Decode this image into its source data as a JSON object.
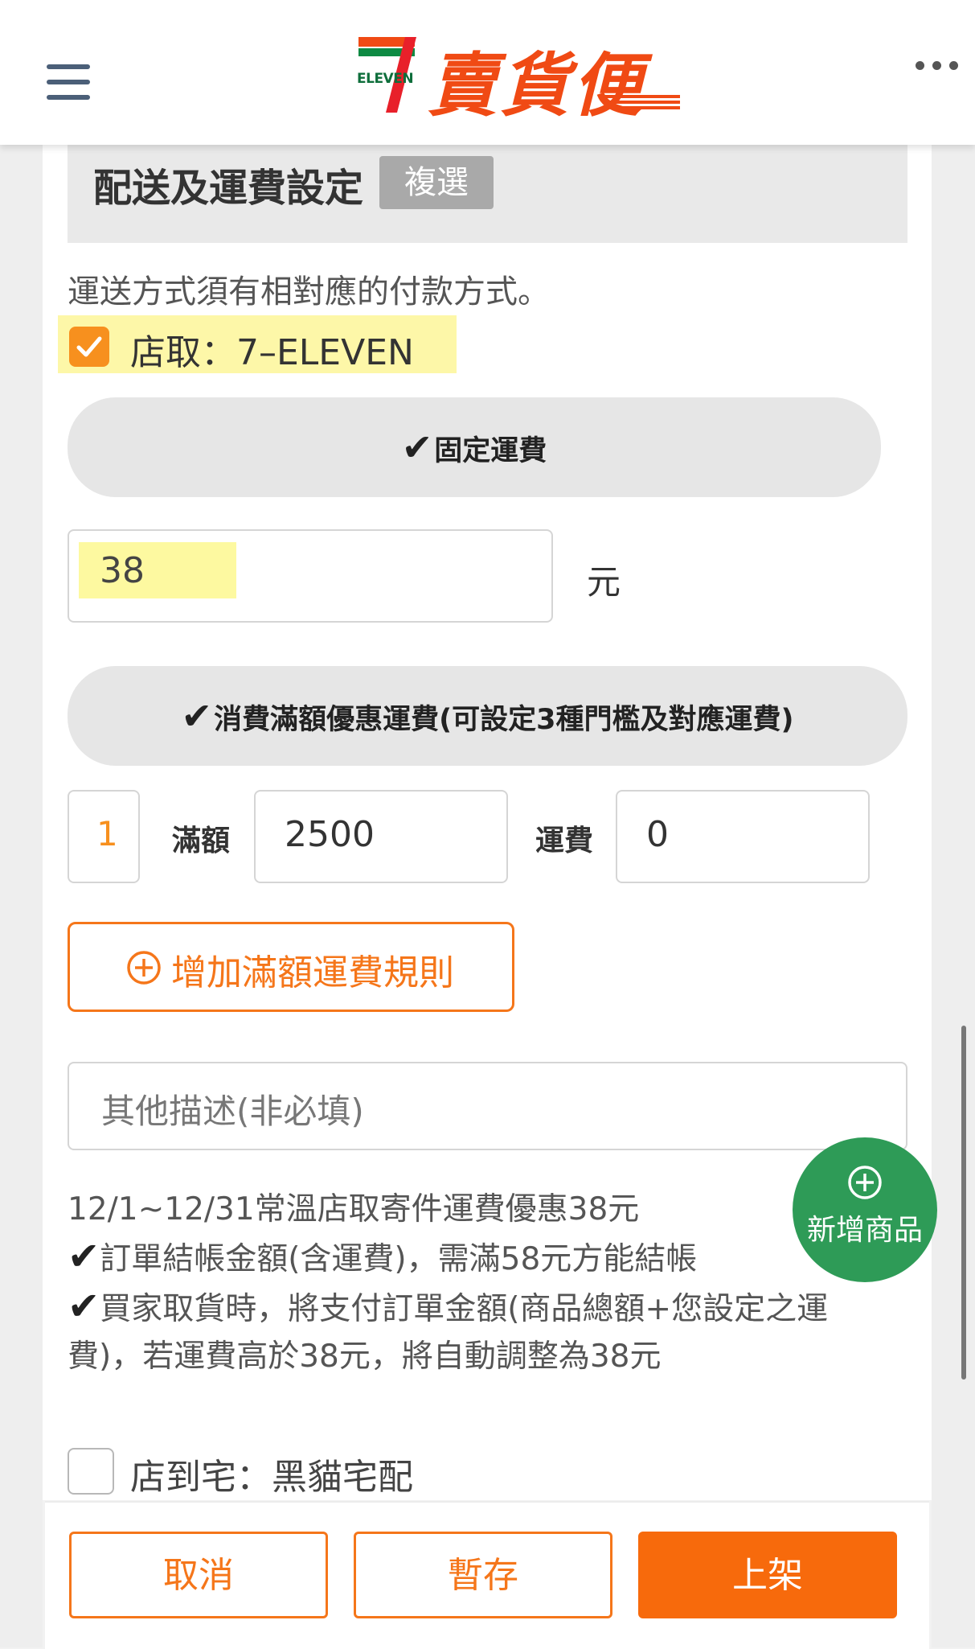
{
  "header": {
    "logo_eleven": "ELEVEN",
    "logo_text": "賣貨便"
  },
  "shipping_section": {
    "title": "配送及運費設定",
    "multi_select_tag": "複選",
    "hint": "運送方式須有相對應的付款方式。",
    "store_pickup": {
      "label": "店取：7–ELEVEN",
      "checked": true
    },
    "fixed_fee": {
      "pill_label": "固定運費",
      "value": "38",
      "unit": "元"
    },
    "threshold": {
      "pill_label": "消費滿額優惠運費(可設定3種門檻及對應運費)",
      "rules": [
        {
          "index": "1",
          "amount_label": "滿額",
          "amount": "2500",
          "fee_label": "運費",
          "fee": "0"
        }
      ],
      "add_rule_label": "增加滿額運費規則"
    },
    "description_placeholder": "其他描述(非必填)",
    "notes": [
      {
        "check": false,
        "text": "12/1~12/31常溫店取寄件運費優惠38元"
      },
      {
        "check": true,
        "text": "訂單結帳金額(含運費)，需滿58元方能結帳"
      },
      {
        "check": true,
        "text": "買家取貨時，將支付訂單金額(商品總額+您設定之運"
      },
      {
        "check": false,
        "text": "費)，若運費高於38元，將自動調整為38元"
      }
    ],
    "home_delivery": {
      "label": "店到宅：黑貓宅配",
      "checked": false
    }
  },
  "fab": {
    "label": "新增商品"
  },
  "footer": {
    "cancel": "取消",
    "save_draft": "暫存",
    "publish": "上架"
  },
  "colors": {
    "accent": "#f5761a",
    "publish": "#f76a0c",
    "checkbox": "#f7901e",
    "fab": "#2e9b57",
    "highlight": "#fdf7a8"
  }
}
